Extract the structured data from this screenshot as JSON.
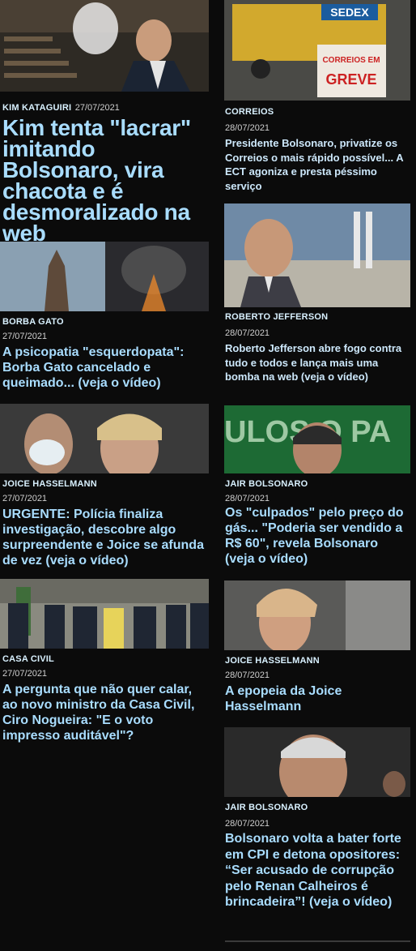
{
  "left": [
    {
      "category": "KIM KATAGUIRI",
      "date": "27/07/2021",
      "title": "Kim tenta \"lacrar\" imitando Bolsonaro, vira chacota e é desmoralizado na web"
    },
    {
      "category": "BORBA GATO",
      "date": "27/07/2021",
      "title": "A psicopatia \"esquerdopata\": Borba Gato cancelado e queimado... (veja o vídeo)"
    },
    {
      "category": "JOICE HASSELMANN",
      "date": "27/07/2021",
      "title": "URGENTE: Polícia finaliza investigação, descobre algo surpreendente e Joice se afunda de vez (veja o vídeo)"
    },
    {
      "category": "CASA CIVIL",
      "date": "27/07/2021",
      "title": "A pergunta que não quer calar, ao novo ministro da Casa Civil, Ciro Nogueira: \"E o voto impresso auditável\"?"
    }
  ],
  "right": [
    {
      "category": "CORREIOS",
      "date": "28/07/2021",
      "title": "Presidente Bolsonaro, privatize os Correios o mais rápido possível... A ECT agoniza e presta péssimo serviço",
      "image_text": {
        "truck": "SEDEX",
        "sign_top": "CORREIOS EM",
        "sign_bottom": "GREVE"
      }
    },
    {
      "category": "ROBERTO JEFFERSON",
      "date": "28/07/2021",
      "title": "Roberto Jefferson abre fogo contra tudo e todos e lança mais uma bomba na web (veja o vídeo)"
    },
    {
      "category": "JAIR BOLSONARO",
      "date": "28/07/2021",
      "title": "Os \"culpados\" pelo preço do gás... \"Poderia ser vendido a R$ 60\", revela Bolsonaro (veja o vídeo)",
      "image_text": {
        "banner": "ULOS O PA"
      }
    },
    {
      "category": "JOICE HASSELMANN",
      "date": "28/07/2021",
      "title": "A epopeia da Joice Hasselmann"
    },
    {
      "category": "JAIR BOLSONARO",
      "date": "28/07/2021",
      "title": "Bolsonaro volta a bater forte em CPI e detona opositores: “Ser acusado de corrupção pelo Renan Calheiros é brincadeira”! (veja o vídeo)"
    }
  ]
}
